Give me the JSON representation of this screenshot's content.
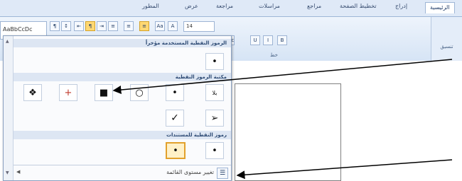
{
  "ribbon": {
    "tabs": [
      {
        "label": "الرئيسية",
        "active": true
      },
      {
        "label": "إدراج",
        "active": false
      },
      {
        "label": "تخطيط الصفحة",
        "active": false
      },
      {
        "label": "مراجع",
        "active": false
      },
      {
        "label": "مراسلات",
        "active": false
      },
      {
        "label": "مراجعة",
        "active": false
      },
      {
        "label": "عرض",
        "active": false
      },
      {
        "label": "المطور",
        "active": false
      }
    ],
    "font_size": "14",
    "style_preview": "AaBbCcDc",
    "right_group": "تنسيق",
    "font_group_label": "خط"
  },
  "panel": {
    "recent_header": "الرموز النقطية المستخدمة مؤخراً",
    "library_header": "مكتبة الرموز النقطية",
    "document_header": "رموز النقطية للمستندات",
    "recent_bullets": [
      "•"
    ],
    "library_bullets": [
      "بلا",
      "•",
      "○",
      "■",
      "+",
      "❖",
      "➢",
      "✓"
    ],
    "document_bullets": [
      "•",
      "•"
    ],
    "footer_label": "تغيير مستوى القائمة"
  },
  "colors": {
    "accent": "#e2a12c",
    "ribbon": "#dfe9f7",
    "header": "#dde6f3"
  }
}
